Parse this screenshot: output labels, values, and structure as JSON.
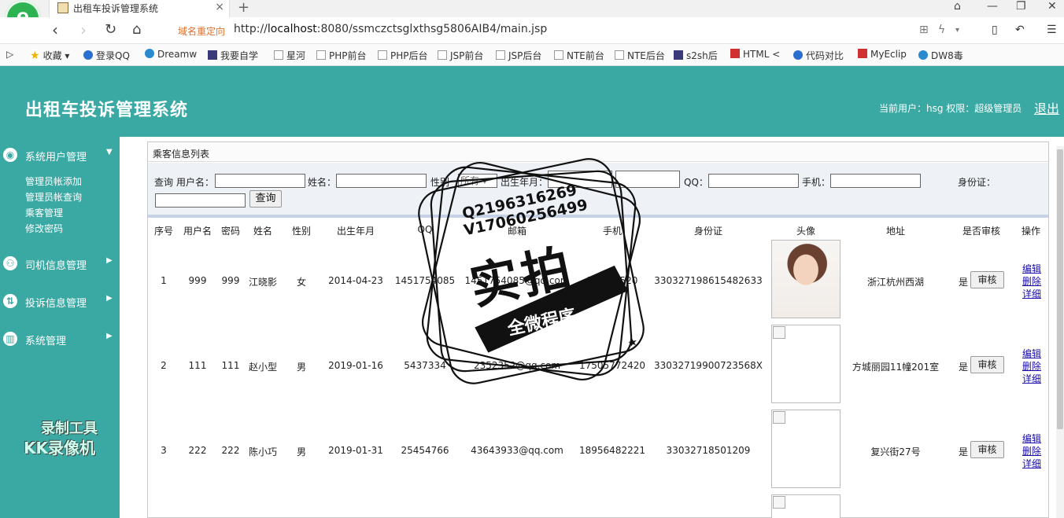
{
  "browser": {
    "logo_letter": "e",
    "tab_title": "出租车投诉管理系统",
    "tab_close": "×",
    "new_tab": "+",
    "redirect_label": "域名重定向",
    "url_prefix": "http://",
    "url_host": "localhost",
    "url_rest": ":8080/ssmczctsglxthsg5806AIB4/main.jsp",
    "bookmarks": [
      "收藏",
      "登录QQ",
      "Dreamw",
      "我要自学",
      "星河",
      "PHP前台",
      "PHP后台",
      "JSP前台",
      "JSP后台",
      "NTE前台",
      "NTE后台",
      "s2sh后",
      "HTML <",
      "代码对比",
      "MyEclip",
      "DW8毒"
    ]
  },
  "header": {
    "title": "出租车投诉管理系统",
    "user_info": "当前用户：hsg  权限：超级管理员",
    "logout_label": "退出"
  },
  "sidebar": {
    "menus": [
      {
        "label": "系统用户管理",
        "icon": "user-icon",
        "subs": [
          "管理员帐添加",
          "管理员帐查询",
          "乘客管理",
          "修改密码"
        ]
      },
      {
        "label": "司机信息管理",
        "icon": "users-icon"
      },
      {
        "label": "投诉信息管理",
        "icon": "complaint-icon"
      },
      {
        "label": "系统管理",
        "icon": "chart-icon"
      }
    ],
    "watermark_line1": "录制工具",
    "watermark_line2": "KK录像机"
  },
  "panel": {
    "title": "乘客信息列表",
    "search": {
      "query_prefix": "查询",
      "username_label": "用户名：",
      "name_label": "姓名：",
      "gender_label": "性别",
      "gender_selected": "所有",
      "birth_label": "出生年月：",
      "qq_label": "QQ：",
      "phone_label": "手机：",
      "idcard_label": "身份证：",
      "search_button": "查询"
    },
    "columns": [
      "序号",
      "用户名",
      "密码",
      "姓名",
      "性别",
      "出生年月",
      "QQ",
      "邮箱",
      "手机",
      "身份证",
      "头像",
      "地址",
      "是否审核",
      "操作"
    ],
    "rows": [
      {
        "no": "1",
        "username": "999",
        "password": "999",
        "name": "江晓影",
        "gender": "女",
        "birth": "2014-04-23",
        "qq": "1451754085",
        "email": "1451754085@qq.com",
        "phone": "1...072520",
        "idcard": "330327198615482633",
        "address": "浙江杭州西湖",
        "audited": "是"
      },
      {
        "no": "2",
        "username": "111",
        "password": "111",
        "name": "赵小型",
        "gender": "男",
        "birth": "2019-01-16",
        "qq": "5437334",
        "email": "2352352@qq.com",
        "phone": "17505772420",
        "idcard": "33032719900723568X",
        "address": "方城丽园11幢201室",
        "audited": "是"
      },
      {
        "no": "3",
        "username": "222",
        "password": "222",
        "name": "陈小巧",
        "gender": "男",
        "birth": "2019-01-31",
        "qq": "25454766",
        "email": "43643933@qq.com",
        "phone": "18956482221",
        "idcard": "33032718501209",
        "address": "复兴街27号",
        "audited": "是"
      }
    ],
    "audit_button": "审核",
    "ops": [
      "编辑",
      "删除",
      "详细"
    ]
  },
  "stamp": {
    "line1": "Q2196316269",
    "line2": "V17060256499",
    "big": "实拍",
    "banner": "全微程序"
  }
}
